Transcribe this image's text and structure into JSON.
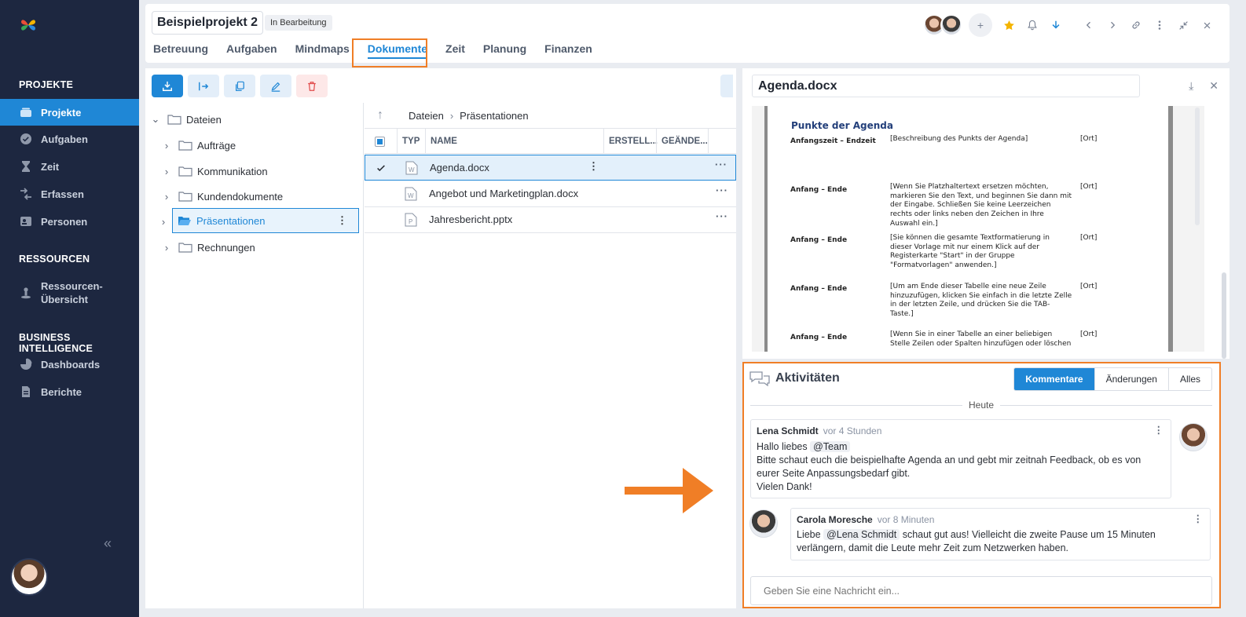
{
  "sidebar": {
    "sections": [
      {
        "title": "PROJEKTE"
      },
      {
        "title": "RESSOURCEN"
      },
      {
        "title": "BUSINESS INTELLIGENCE"
      }
    ],
    "items": [
      {
        "label": "Projekte",
        "icon": "folder-stack-icon",
        "active": true
      },
      {
        "label": "Aufgaben",
        "icon": "check-circle-icon"
      },
      {
        "label": "Zeit",
        "icon": "hourglass-icon"
      },
      {
        "label": "Erfassen",
        "icon": "clock-arrows-icon"
      },
      {
        "label": "Personen",
        "icon": "person-card-icon"
      },
      {
        "label": "Ressourcen-\nÜbersicht",
        "icon": "resource-icon"
      },
      {
        "label": "Dashboards",
        "icon": "pie-icon"
      },
      {
        "label": "Berichte",
        "icon": "report-icon"
      }
    ],
    "collapse": "«"
  },
  "header": {
    "project_title": "Beispielprojekt 2",
    "status": "In Bearbeitung",
    "tabs": [
      "Betreuung",
      "Aufgaben",
      "Mindmaps",
      "Dokumente",
      "Zeit",
      "Planung",
      "Finanzen"
    ],
    "active_tab": "Dokumente",
    "add_label": "+"
  },
  "docs": {
    "tree": {
      "root": "Dateien",
      "folders": [
        "Aufträge",
        "Kommunikation",
        "Kundendokumente",
        "Präsentationen",
        "Rechnungen"
      ],
      "selected": "Präsentationen"
    },
    "breadcrumb": [
      "Dateien",
      "Präsentationen"
    ],
    "columns": [
      "TYP",
      "NAME",
      "ERSTELL...",
      "GEÄNDE..."
    ],
    "files": [
      {
        "name": "Agenda.docx",
        "type": "word",
        "selected": true
      },
      {
        "name": "Angebot und Marketingplan.docx",
        "type": "word"
      },
      {
        "name": "Jahresbericht.pptx",
        "type": "powerpoint"
      }
    ]
  },
  "preview": {
    "title": "Agenda.docx",
    "heading": "Punkte der Agenda",
    "rows": [
      {
        "time": "Anfangszeit – Endzeit",
        "desc": "[Beschreibung des Punkts der Agenda]",
        "ort": "[Ort]"
      },
      {
        "time": "Anfang – Ende",
        "desc": "[Wenn Sie Platzhaltertext ersetzen möchten, markieren Sie den Text, und beginnen Sie dann mit der Eingabe. Schließen Sie keine Leerzeichen rechts oder links neben den Zeichen in Ihre Auswahl ein.]",
        "ort": "[Ort]"
      },
      {
        "time": "Anfang – Ende",
        "desc": "[Sie können die gesamte Textformatierung in dieser Vorlage mit nur einem Klick auf der Registerkarte \"Start\" in der Gruppe \"Formatvorlagen\" anwenden.]",
        "ort": "[Ort]"
      },
      {
        "time": "Anfang – Ende",
        "desc": "[Um am Ende dieser Tabelle eine neue Zeile hinzuzufügen, klicken Sie einfach in die letzte Zelle in der letzten Zeile, und drücken Sie die TAB-Taste.]",
        "ort": "[Ort]"
      },
      {
        "time": "Anfang – Ende",
        "desc": "[Wenn Sie in einer Tabelle an einer beliebigen Stelle Zeilen oder Spalten hinzufügen oder löschen",
        "ort": "[Ort]"
      }
    ]
  },
  "activities": {
    "title": "Aktivitäten",
    "filters": [
      "Kommentare",
      "Änderungen",
      "Alles"
    ],
    "active_filter": "Kommentare",
    "day_label": "Heute",
    "comments": [
      {
        "author": "Lena Schmidt",
        "time": "vor 4 Stunden",
        "greeting": "Hallo liebes",
        "mention": "@Team",
        "line2": "Bitte schaut euch die beispielhafte Agenda an und gebt mir zeitnah Feedback, ob es von eurer Seite Anpassungsbedarf gibt.",
        "line3": "Vielen Dank!"
      },
      {
        "author": "Carola Moresche",
        "time": "vor 8 Minuten",
        "greeting": "Liebe",
        "mention": "@Lena Schmidt",
        "text": "schaut gut aus! Vielleicht die zweite Pause um 15 Minuten verlängern, damit die Leute mehr Zeit zum Netzwerken haben."
      }
    ],
    "input_placeholder": "Geben Sie eine Nachricht ein..."
  },
  "colors": {
    "accent": "#1f87d6",
    "highlight": "#f07e26",
    "sidebar": "#1d2740"
  }
}
